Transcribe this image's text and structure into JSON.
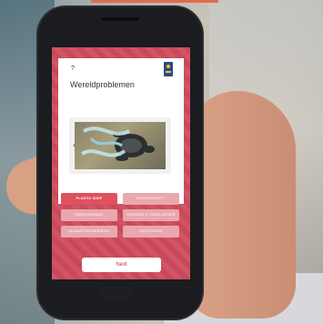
{
  "app": {
    "help_label": "?",
    "title": "Wereldproblemen"
  },
  "image": {
    "description_icon": "turtle-in-plastic-image",
    "prev_label": "‹",
    "next_label": "›"
  },
  "options": [
    {
      "label": "PLASTIC SOEP",
      "selected": true
    },
    {
      "label": "BIODIVERSITEIT",
      "selected": false
    },
    {
      "label": "ENERGIEARMOE",
      "selected": false
    },
    {
      "label": "ARMOEDE & ONGELIJKHEID",
      "selected": false
    },
    {
      "label": "KLIMAATVERANDERING",
      "selected": false
    },
    {
      "label": "ONTBOSSING",
      "selected": false
    }
  ],
  "footer": {
    "next_button_label": "Next"
  },
  "colors": {
    "screen_bg": "#cf4b5d",
    "option_selected": "#e0515f",
    "option_default": "#e9a7ae",
    "next_text": "#c33a4b"
  }
}
